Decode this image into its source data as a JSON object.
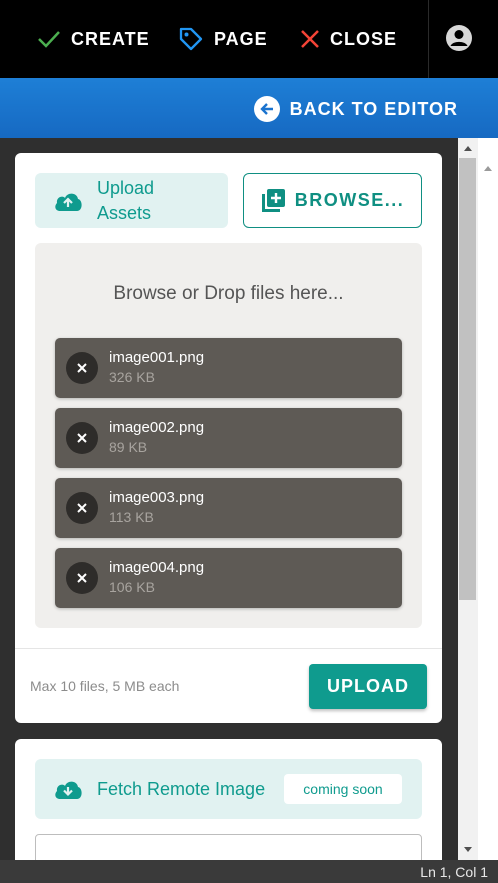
{
  "toolbar": {
    "create_label": "CREATE",
    "page_label": "PAGE",
    "close_label": "CLOSE",
    "colors": {
      "check": "#4caf50",
      "tag": "#2196f3",
      "close": "#f44336"
    }
  },
  "nav": {
    "back_label": "BACK TO EDITOR"
  },
  "upload_card": {
    "chip_label": "Upload Assets",
    "chip_line1": "Upload",
    "chip_line2": "Assets",
    "browse_label": "BROWSE...",
    "dropzone_text": "Browse or Drop files here...",
    "files": [
      {
        "name": "image001.png",
        "size": "326 KB"
      },
      {
        "name": "image002.png",
        "size": "89 KB"
      },
      {
        "name": "image003.png",
        "size": "113 KB"
      },
      {
        "name": "image004.png",
        "size": "106 KB"
      }
    ],
    "limits_text": "Max 10 files, 5 MB each",
    "upload_label": "UPLOAD"
  },
  "fetch_card": {
    "title": "Fetch Remote Image",
    "badge": "coming soon",
    "url_value": ""
  },
  "status": {
    "cursor": "Ln 1, Col 1"
  },
  "theme": {
    "accent": "#0f9b8e",
    "primary": "#1976d2"
  }
}
